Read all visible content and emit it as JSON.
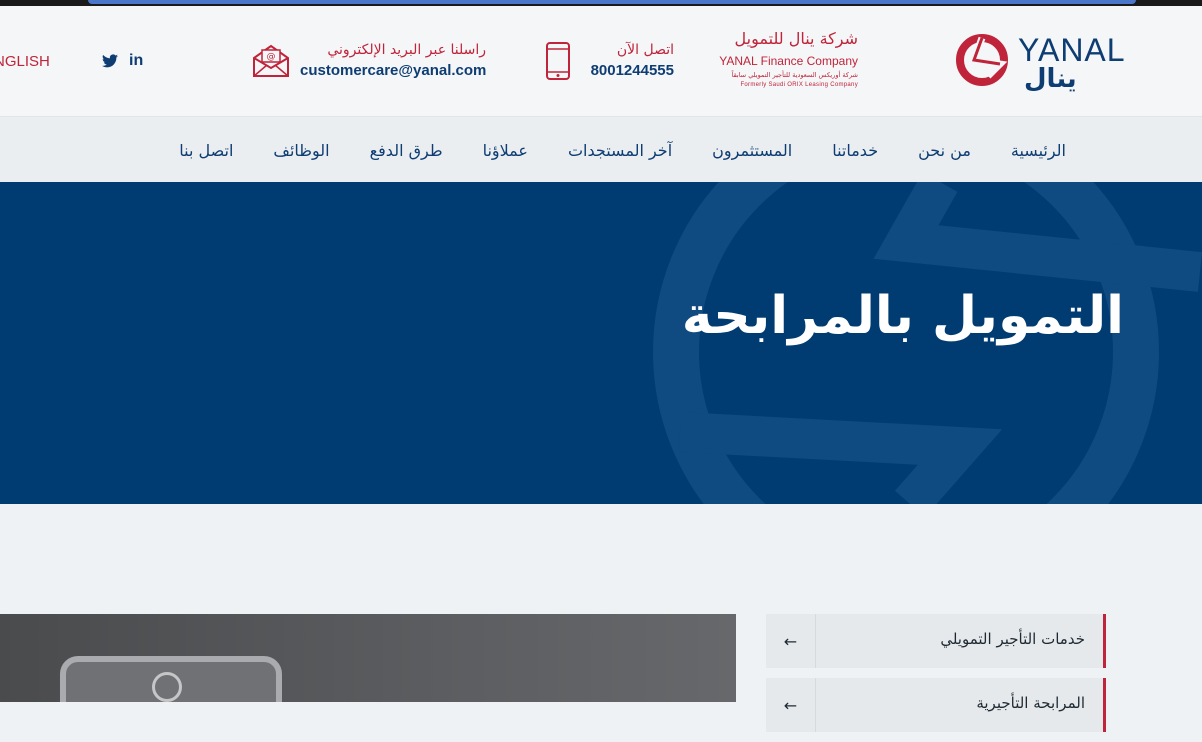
{
  "header": {
    "logo": {
      "en": "YANAL",
      "ar": "ينال"
    },
    "company": {
      "name_ar": "شركة ينال للتمويل",
      "name_en": "YANAL Finance Company",
      "formerly_ar": "شركة أوريكس السعودية للتأجير التمويلي سابقاً",
      "formerly_en": "Formerly Saudi ORIX Leasing Company"
    },
    "phone": {
      "label": "اتصل الآن",
      "value": "8001244555",
      "icon": "mobile-phone-icon"
    },
    "email": {
      "label": "راسلنا عبر البريد الإلكتروني",
      "value": "customercare@yanal.com",
      "icon": "envelope-icon"
    },
    "social": {
      "linkedin": "in",
      "twitter_icon": "twitter-icon"
    },
    "language": "NGLISH"
  },
  "nav": {
    "items": [
      {
        "label": "الرئيسية"
      },
      {
        "label": "من نحن"
      },
      {
        "label": "خدماتنا"
      },
      {
        "label": "المستثمرون"
      },
      {
        "label": "آخر المستجدات"
      },
      {
        "label": "عملاؤنا"
      },
      {
        "label": "طرق الدفع"
      },
      {
        "label": "الوظائف"
      },
      {
        "label": "اتصل بنا"
      }
    ]
  },
  "hero": {
    "title": "التمويل بالمرابحة"
  },
  "sidebar": {
    "items": [
      {
        "label": "خدمات التأجير التمويلي",
        "arrow": "←"
      },
      {
        "label": "المرابحة التأجيرية",
        "arrow": "←"
      }
    ]
  },
  "colors": {
    "brand_blue": "#003b72",
    "brand_red": "#c0243a"
  }
}
